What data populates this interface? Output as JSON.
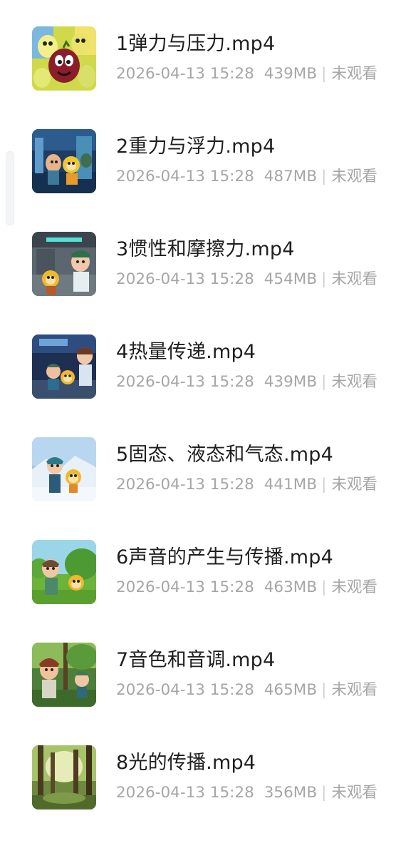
{
  "files": [
    {
      "name": "1弹力与压力.mp4",
      "date": "2026-04-13 15:28",
      "size": "439MB",
      "status": "未观看",
      "thumb": "cartoon-characters-thumbnail"
    },
    {
      "name": "2重力与浮力.mp4",
      "date": "2026-04-13 15:28",
      "size": "487MB",
      "status": "未观看",
      "thumb": "lab-scene-thumbnail"
    },
    {
      "name": "3惯性和摩擦力.mp4",
      "date": "2026-04-13 15:28",
      "size": "454MB",
      "status": "未观看",
      "thumb": "corridor-scene-thumbnail"
    },
    {
      "name": "4热量传递.mp4",
      "date": "2026-04-13 15:28",
      "size": "439MB",
      "status": "未观看",
      "thumb": "indoor-scene-thumbnail"
    },
    {
      "name": "5固态、液态和气态.mp4",
      "date": "2026-04-13 15:28",
      "size": "441MB",
      "status": "未观看",
      "thumb": "snow-scene-thumbnail"
    },
    {
      "name": "6声音的产生与传播.mp4",
      "date": "2026-04-13 15:28",
      "size": "463MB",
      "status": "未观看",
      "thumb": "meadow-scene-thumbnail"
    },
    {
      "name": "7音色和音调.mp4",
      "date": "2026-04-13 15:28",
      "size": "465MB",
      "status": "未观看",
      "thumb": "forest-characters-thumbnail"
    },
    {
      "name": "8光的传播.mp4",
      "date": "2026-04-13 15:28",
      "size": "356MB",
      "status": "未观看",
      "thumb": "forest-light-thumbnail"
    }
  ]
}
